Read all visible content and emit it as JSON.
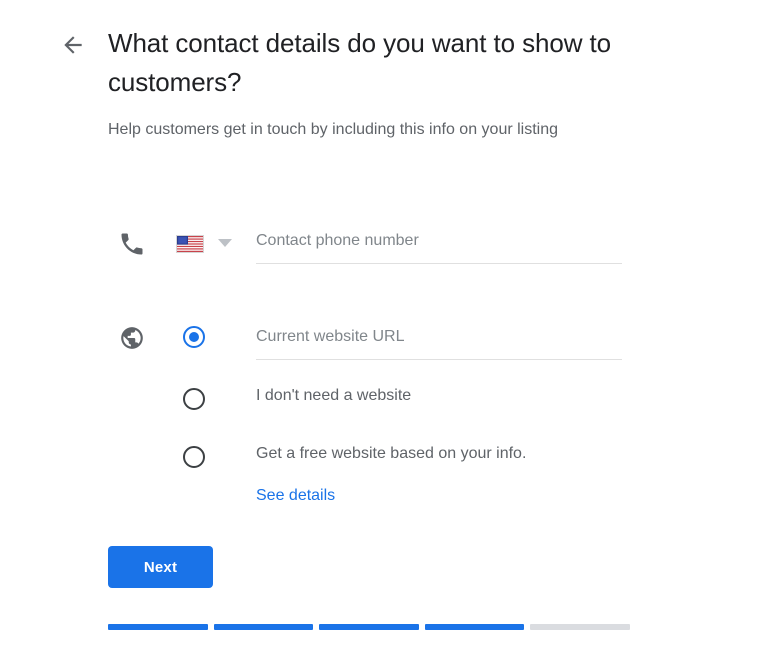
{
  "header": {
    "back_icon": "arrow-left-icon",
    "title": "What contact details do you want to show to customers?",
    "subtitle": "Help customers get in touch by including this info on your listing"
  },
  "phone_row": {
    "icon": "phone-icon",
    "country_flag": "us-flag-icon",
    "country_caret": "chevron-down-icon",
    "placeholder": "Contact phone number",
    "value": ""
  },
  "website_section": {
    "icon": "globe-icon",
    "selected_index": 0,
    "options": [
      {
        "type": "input",
        "placeholder": "Current website URL",
        "value": ""
      },
      {
        "type": "label",
        "label": "I don't need a website"
      },
      {
        "type": "label",
        "label": "Get a free website based on your info."
      }
    ],
    "see_details_label": "See details"
  },
  "footer": {
    "next_label": "Next",
    "progress": {
      "total": 5,
      "completed": 4,
      "segments": [
        "done",
        "done",
        "done",
        "done",
        "todo"
      ]
    }
  },
  "colors": {
    "accent": "#1a73e8",
    "text_primary": "#202124",
    "text_secondary": "#5f6368",
    "placeholder": "#80868b",
    "divider": "#e0e0e0",
    "progress_track": "#dadce0"
  }
}
